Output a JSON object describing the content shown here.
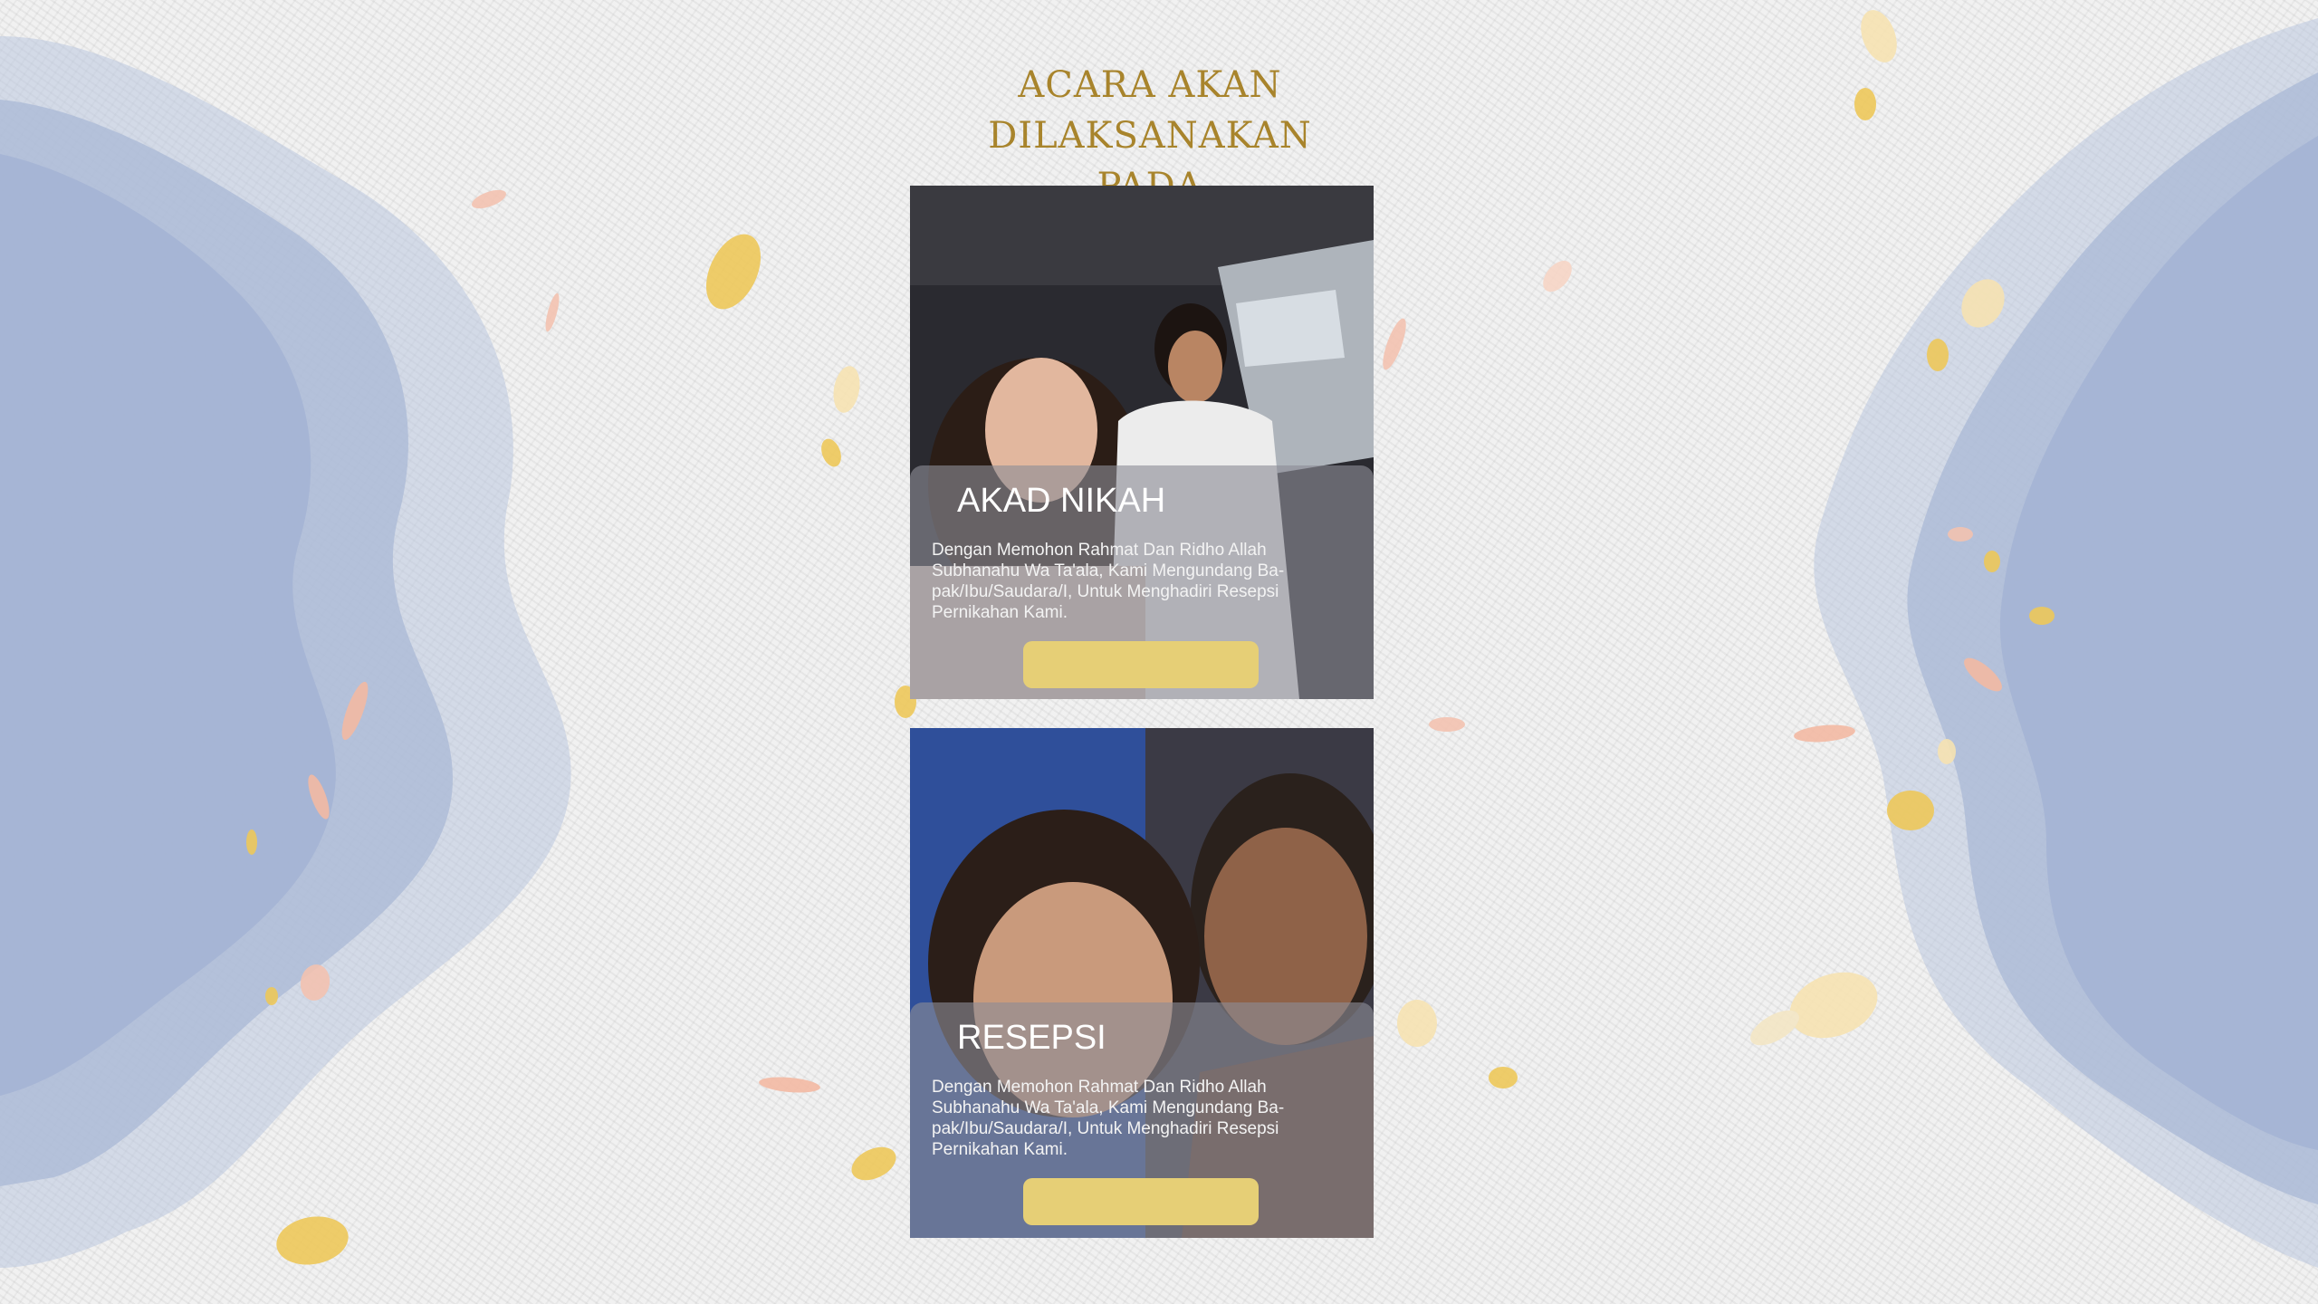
{
  "heading": {
    "line1": "ACARA AKAN DILAKSANAKAN",
    "line2": "PADA"
  },
  "events": [
    {
      "title": "AKAD NIKAH",
      "description": "Dengan Memohon Rahmat Dan Ridho Allah Subhanahu Wa Ta'ala, Kami Mengundang Ba-pak/Ibu/Saudara/I, Untuk Menghadiri Resepsi Pernikahan Kami.",
      "button_label": ""
    },
    {
      "title": "RESEPSI",
      "description": "Dengan Memohon Rahmat Dan Ridho Allah Subhanahu Wa Ta'ala, Kami Mengundang Ba-pak/Ibu/Saudara/I, Untuk Menghadiri Resepsi Pernikahan Kami.",
      "button_label": ""
    }
  ],
  "colors": {
    "accent_gold": "#a8842c",
    "button_gold": "#e6cf76",
    "wave_blue": "#a9b8d6"
  }
}
